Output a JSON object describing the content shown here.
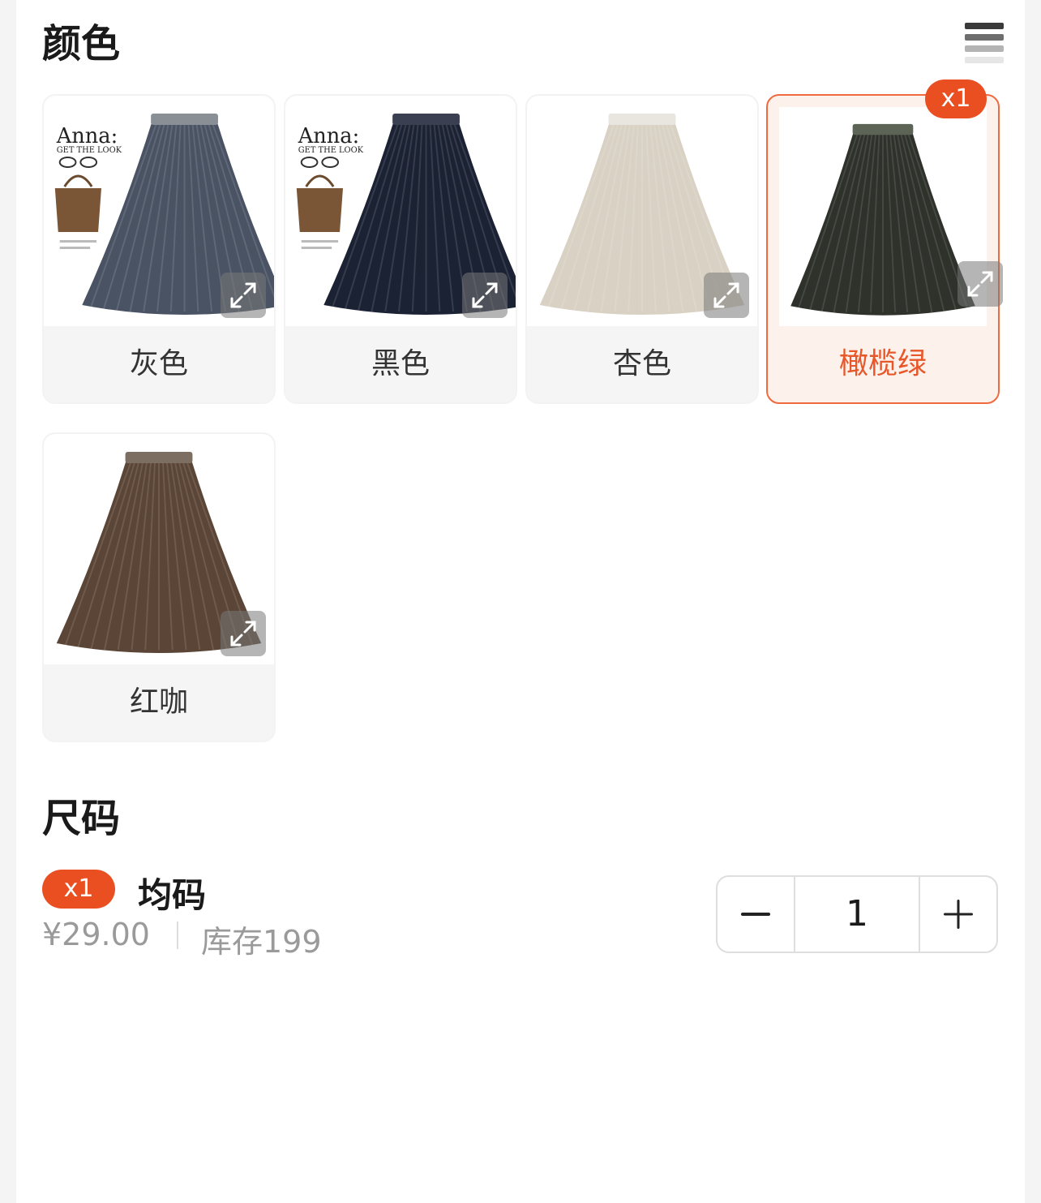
{
  "color_section": {
    "title": "颜色",
    "options": [
      {
        "label": "灰色",
        "skirt_color": "#4a5363",
        "band_color": "#8a8f96",
        "has_magazine": true
      },
      {
        "label": "黑色",
        "skirt_color": "#1b2233",
        "band_color": "#3a4052",
        "has_magazine": true
      },
      {
        "label": "杏色",
        "skirt_color": "#d9d2c4",
        "band_color": "#e9e6df",
        "has_magazine": false
      },
      {
        "label": "橄榄绿",
        "skirt_color": "#2e322b",
        "band_color": "#5c6456",
        "has_magazine": false,
        "selected": true,
        "quantity_badge": "x1"
      },
      {
        "label": "红咖",
        "skirt_color": "#5a4536",
        "band_color": "#7c6e60",
        "has_magazine": false
      }
    ],
    "magazine_text": {
      "brand": "Anna:",
      "tagline": "GET THE LOOK"
    }
  },
  "size_section": {
    "title": "尺码",
    "item": {
      "quantity_badge": "x1",
      "name": "均码",
      "price": "¥29.00",
      "stock": "库存199",
      "quantity": "1"
    }
  },
  "colors": {
    "accent": "#ea4f22",
    "selected_bg": "#fdf1ec",
    "selected_border": "#f06a3f"
  }
}
